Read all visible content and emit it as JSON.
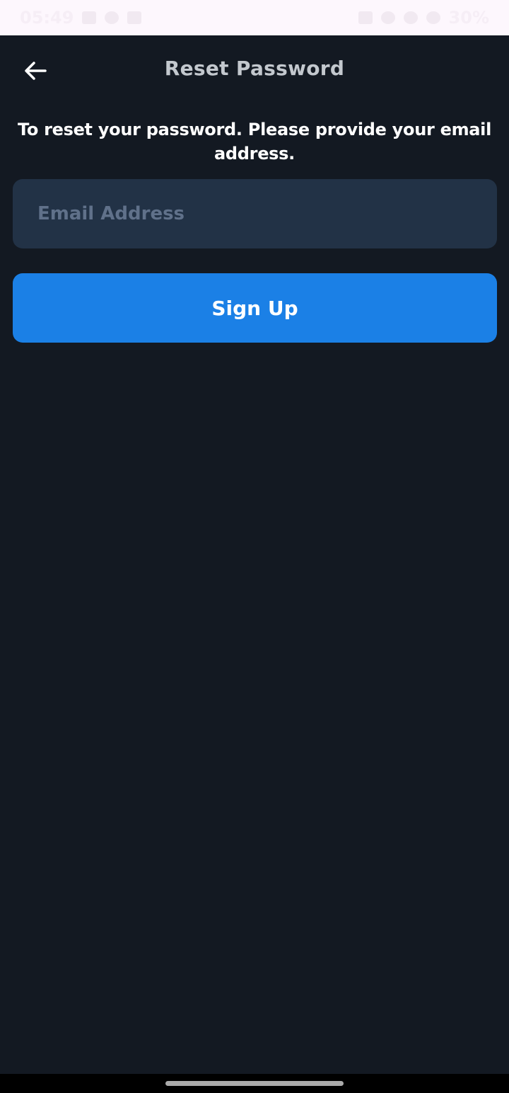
{
  "status_bar": {
    "time": "05:49",
    "battery": "30%"
  },
  "header": {
    "title": "Reset Password",
    "back_icon": "arrow-left-icon"
  },
  "instructions": "To reset your password. Please provide your email address.",
  "email_field": {
    "placeholder": "Email Address",
    "value": ""
  },
  "submit_button": {
    "label": "Sign Up"
  },
  "colors": {
    "background": "#131922",
    "input_background": "#223246",
    "accent": "#1b80e6",
    "title_text": "#c3c8ce",
    "placeholder_text": "#60718a"
  }
}
